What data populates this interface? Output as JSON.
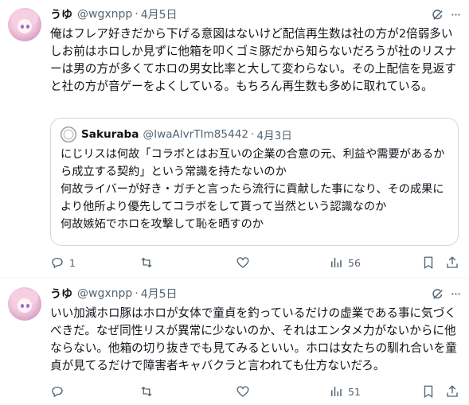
{
  "tweets": [
    {
      "name": "うゆ",
      "handle": "@wgxnpp",
      "dot": "·",
      "time": "4月5日",
      "text": "俺はフレア好きだから下げる意図はないけど配信再生数は社の方が2倍弱多いしお前はホロしか見ずに他箱を叩くゴミ豚だから知らないだろうが社のリスナーは男の方が多くてホロの男女比率と大して変わらない。その上配信を見返すと社の方が音ゲーをよくしている。もちろん再生数も多めに取れている。",
      "quote": {
        "name": "Sakuraba",
        "handle": "@IwaAlvrTIm85442",
        "dot": "·",
        "time": "4月3日",
        "lines": [
          "にじリスは何故「コラボとはお互いの企業の合意の元、利益や需要があるから成立する契約」という常識を持たないのか",
          "何故ライバーが好き・ガチと言ったら流行に貢献した事になり、その成果により他所より優先してコラボをして貰って当然という認識なのか",
          "何故嫉妬でホロを攻撃して恥を晒すのか"
        ]
      },
      "actions": {
        "reply": "1",
        "retweet": "",
        "like": "",
        "views": "56",
        "bookmark": "",
        "share": ""
      }
    },
    {
      "name": "うゆ",
      "handle": "@wgxnpp",
      "dot": "·",
      "time": "4月5日",
      "text": "いい加減ホロ豚はホロが女体で童貞を釣っているだけの虚業である事に気づくべきだ。なぜ同性リスが異常に少ないのか、それはエンタメ力がないからに他ならない。他箱の切り抜きでも見てみるといい。ホロは女たちの馴れ合いを童貞が見てるだけで障害者キャバクラと言われても仕方ないだろ。",
      "actions": {
        "reply": "",
        "retweet": "",
        "like": "",
        "views": "51",
        "bookmark": "",
        "share": ""
      }
    }
  ],
  "icons": {
    "grok": "grok-icon",
    "more": "more-icon",
    "reply": "reply-icon",
    "retweet": "retweet-icon",
    "like": "like-icon",
    "views": "views-icon",
    "bookmark": "bookmark-icon",
    "share": "share-icon"
  },
  "colors": {
    "text": "#0f1419",
    "secondary": "#536471",
    "border": "#cfd9de",
    "divider": "#eff3f4"
  },
  "more_glyph": "···"
}
